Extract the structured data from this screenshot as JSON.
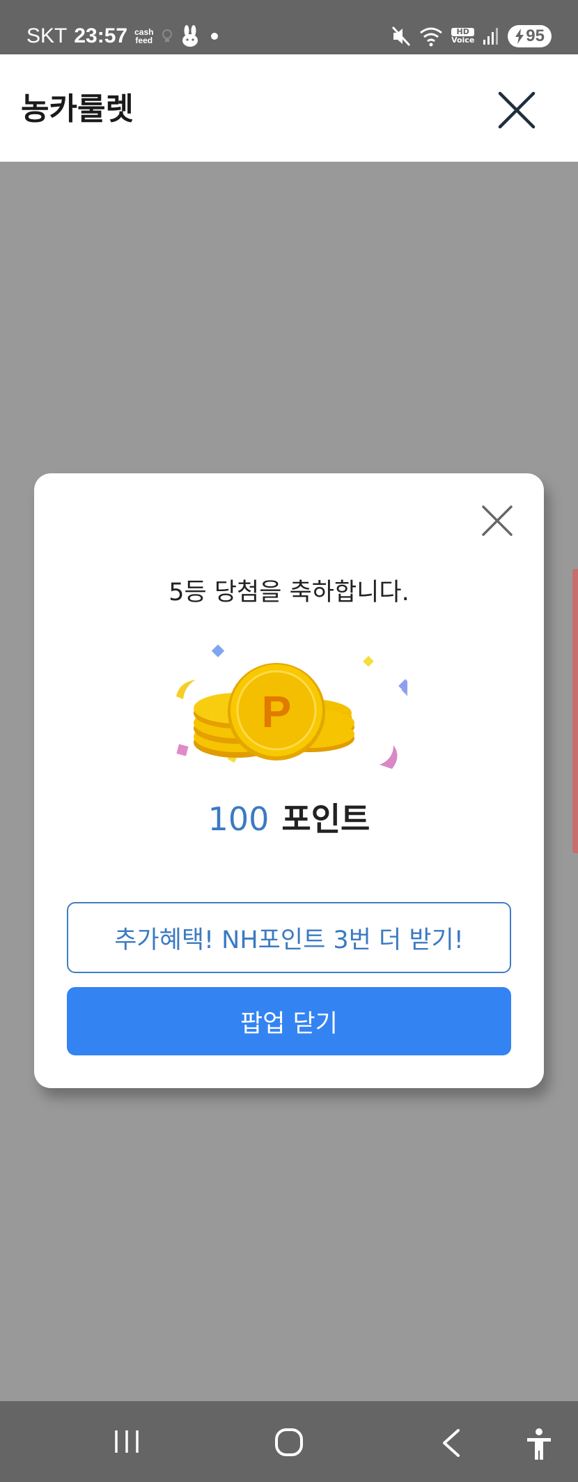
{
  "status_bar": {
    "carrier": "SKT",
    "time": "23:57",
    "notification_icons": [
      "cash-feed-icon",
      "bulb-icon",
      "rabbit-icon",
      "dot-icon"
    ],
    "cash_feed_line1": "cash",
    "cash_feed_line2": "feed",
    "hd_voice_line1": "HD",
    "hd_voice_line2": "Voice",
    "battery": "95",
    "right_icons": [
      "mute-icon",
      "wifi-6-icon",
      "hd-voice-icon",
      "signal-icon",
      "battery-charging-icon"
    ]
  },
  "header": {
    "title": "농카룰렛",
    "close_icon": "close-icon"
  },
  "modal": {
    "message": "5등 당첨을 축하합니다.",
    "illustration": "coins-icon",
    "coin_letter": "P",
    "points_value": "100",
    "points_unit": "포인트",
    "extra_button_label": "추가혜택! NH포인트 3번 더 받기!",
    "close_button_label": "팝업 닫기"
  },
  "nav_bar": {
    "items": [
      "recent-apps-icon",
      "home-icon",
      "back-icon",
      "accessibility-icon"
    ]
  },
  "colors": {
    "accent_blue": "#3383f3",
    "points_blue": "#3b7ac2",
    "overlay_gray": "#999999",
    "system_bar": "#656565",
    "coin_gold": "#f5c400"
  }
}
